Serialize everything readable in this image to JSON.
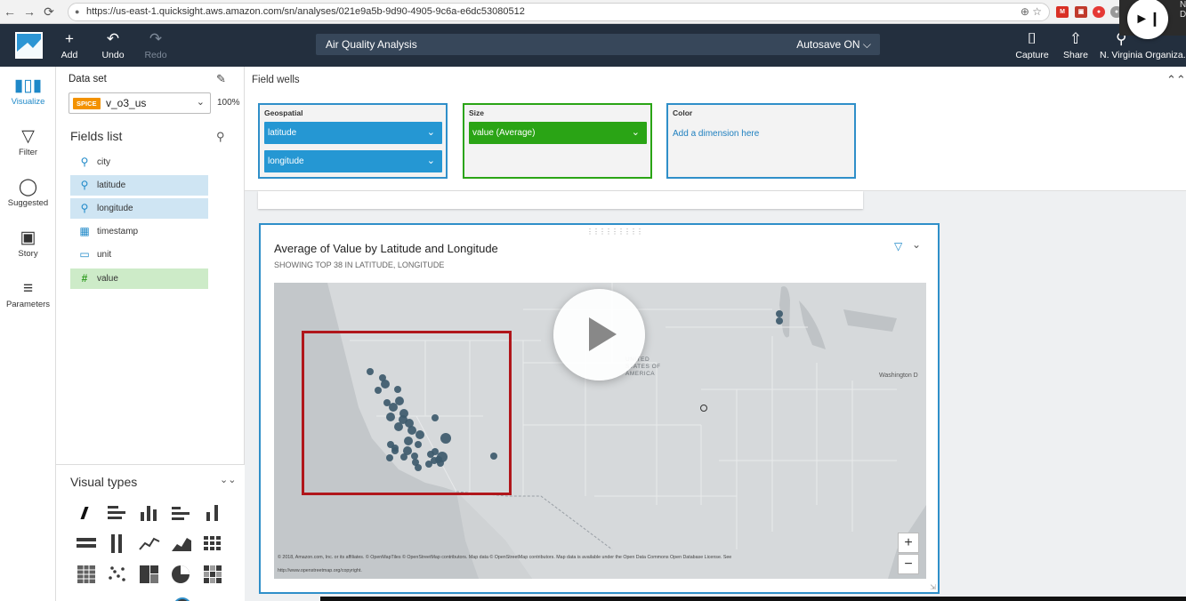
{
  "browser": {
    "url": "https://us-east-1.quicksight.aws.amazon.com/sn/analyses/021e9a5b-9d90-4905-9c6a-e6dc53080512",
    "back_glyph": "←",
    "forward_glyph": "→",
    "reload_glyph": "⟳",
    "lock_glyph": "🔒",
    "url_tools": "⊕  ☆"
  },
  "header": {
    "add_label": "Add",
    "undo_label": "Undo",
    "redo_label": "Redo",
    "analysis_title": "Air Quality Analysis",
    "autosave_label": "Autosave ON ⌵",
    "capture_label": "Capture",
    "share_label": "Share",
    "account_label": "N. Virginia Organiza...",
    "add_glyph": "+",
    "undo_glyph": "↶",
    "redo_glyph": "↷",
    "capture_glyph": "⌷",
    "share_glyph": "⇧",
    "account_glyph": "⚲"
  },
  "rail": {
    "visualize_label": "Visualize",
    "filter_label": "Filter",
    "suggested_label": "Suggested",
    "story_label": "Story",
    "parameters_label": "Parameters"
  },
  "dataset": {
    "label": "Data set",
    "badge": "SPICE",
    "name": "v_o3_us",
    "percent": "100%"
  },
  "fields": {
    "title": "Fields list",
    "items": [
      {
        "name": "city",
        "icon": "geo-pin-icon"
      },
      {
        "name": "latitude",
        "icon": "geo-pin-icon"
      },
      {
        "name": "longitude",
        "icon": "geo-pin-icon"
      },
      {
        "name": "timestamp",
        "icon": "calendar-icon"
      },
      {
        "name": "unit",
        "icon": "tag-icon"
      },
      {
        "name": "value",
        "icon": "hash-icon"
      }
    ]
  },
  "visual_types": {
    "title": "Visual types"
  },
  "field_wells": {
    "title": "Field wells",
    "geospatial": {
      "title": "Geospatial",
      "pills": [
        "latitude",
        "longitude"
      ]
    },
    "size": {
      "title": "Size",
      "pills": [
        "value (Average)"
      ]
    },
    "color": {
      "title": "Color",
      "placeholder": "Add a dimension here"
    }
  },
  "visual": {
    "title": "Average of Value by Latitude and Longitude",
    "subtitle": "SHOWING TOP 38 IN LATITUDE, LONGITUDE",
    "map_label_country": "UNITED STATES OF AMERICA",
    "map_label_city": "Washington D",
    "attribution": "© 2018, Amazon.com, Inc. or its affiliates. © OpenMapTiles © OpenStreetMap contributors. Map data © OpenStreetMap contributors. Map data is available under the Open Data Commons Open Database License. See",
    "attribution_link": "http://www.openstreetmap.org/copyright.",
    "zoom_in": "+",
    "zoom_out": "−"
  },
  "colors": {
    "accent": "#2597d3",
    "measure": "#2aa415",
    "header_bg": "#232f3e",
    "highlight": "#b0161b",
    "map_point": "#3d5a6c"
  }
}
